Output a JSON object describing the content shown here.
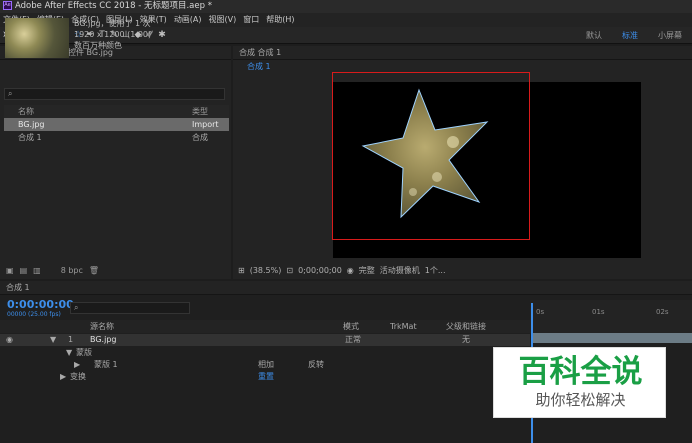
{
  "app": {
    "title": "Adobe After Effects CC 2018 - 无标题项目.aep *",
    "logo": "Ae"
  },
  "menu": [
    "文件(F)",
    "编辑(E)",
    "合成(C)",
    "图层(L)",
    "效果(T)",
    "动画(A)",
    "视图(V)",
    "窗口",
    "帮助(H)"
  ],
  "workspaces": [
    "默认",
    "标准",
    "小屏幕"
  ],
  "workspace_active": "标准",
  "project": {
    "tab1": "项目",
    "tab2": "效果控件 BG.jpg",
    "file_name": "BG.jpg",
    "used_info": "，使用了 1 次",
    "dimensions": "1920 x 1200 (1.00)",
    "color_label": "数百万种颜色",
    "search_icon": "⌕",
    "col_name": "名称",
    "col_type": "类型",
    "rows": [
      {
        "name": "BG.jpg",
        "type": "Import"
      },
      {
        "name": "合成 1",
        "type": "合成"
      }
    ],
    "bpc": "8 bpc"
  },
  "comp": {
    "tab": "合成 合成 1",
    "subtab": "合成 1",
    "zoom": "(38.5%)",
    "timecode": "0;00;00;00",
    "quality": "完整",
    "camera": "活动摄像机",
    "views": "1个..."
  },
  "timeline": {
    "tab": "合成 1",
    "timecode": "0:00:00:00",
    "frames": "00000 (25.00 fps)",
    "cols": {
      "source": "源名称",
      "mode": "模式",
      "trkmat": "TrkMat",
      "parent": "父级和链接"
    },
    "layer": {
      "num": "1",
      "name": "BG.jpg",
      "mode": "正常",
      "parent": "无"
    },
    "mask_group": "蒙版",
    "mask": "蒙版 1",
    "mask_mode": "相加",
    "invert": "反转",
    "transform": "变换",
    "reset": "重置",
    "ruler": [
      "0s",
      "01s",
      "02s"
    ]
  },
  "watermark": {
    "line1": "百科全说",
    "line2": "助你轻松解决"
  },
  "colors": {
    "accent": "#3d8eea",
    "highlight_box": "#d81b1b",
    "watermark_green": "#1a9f45"
  }
}
